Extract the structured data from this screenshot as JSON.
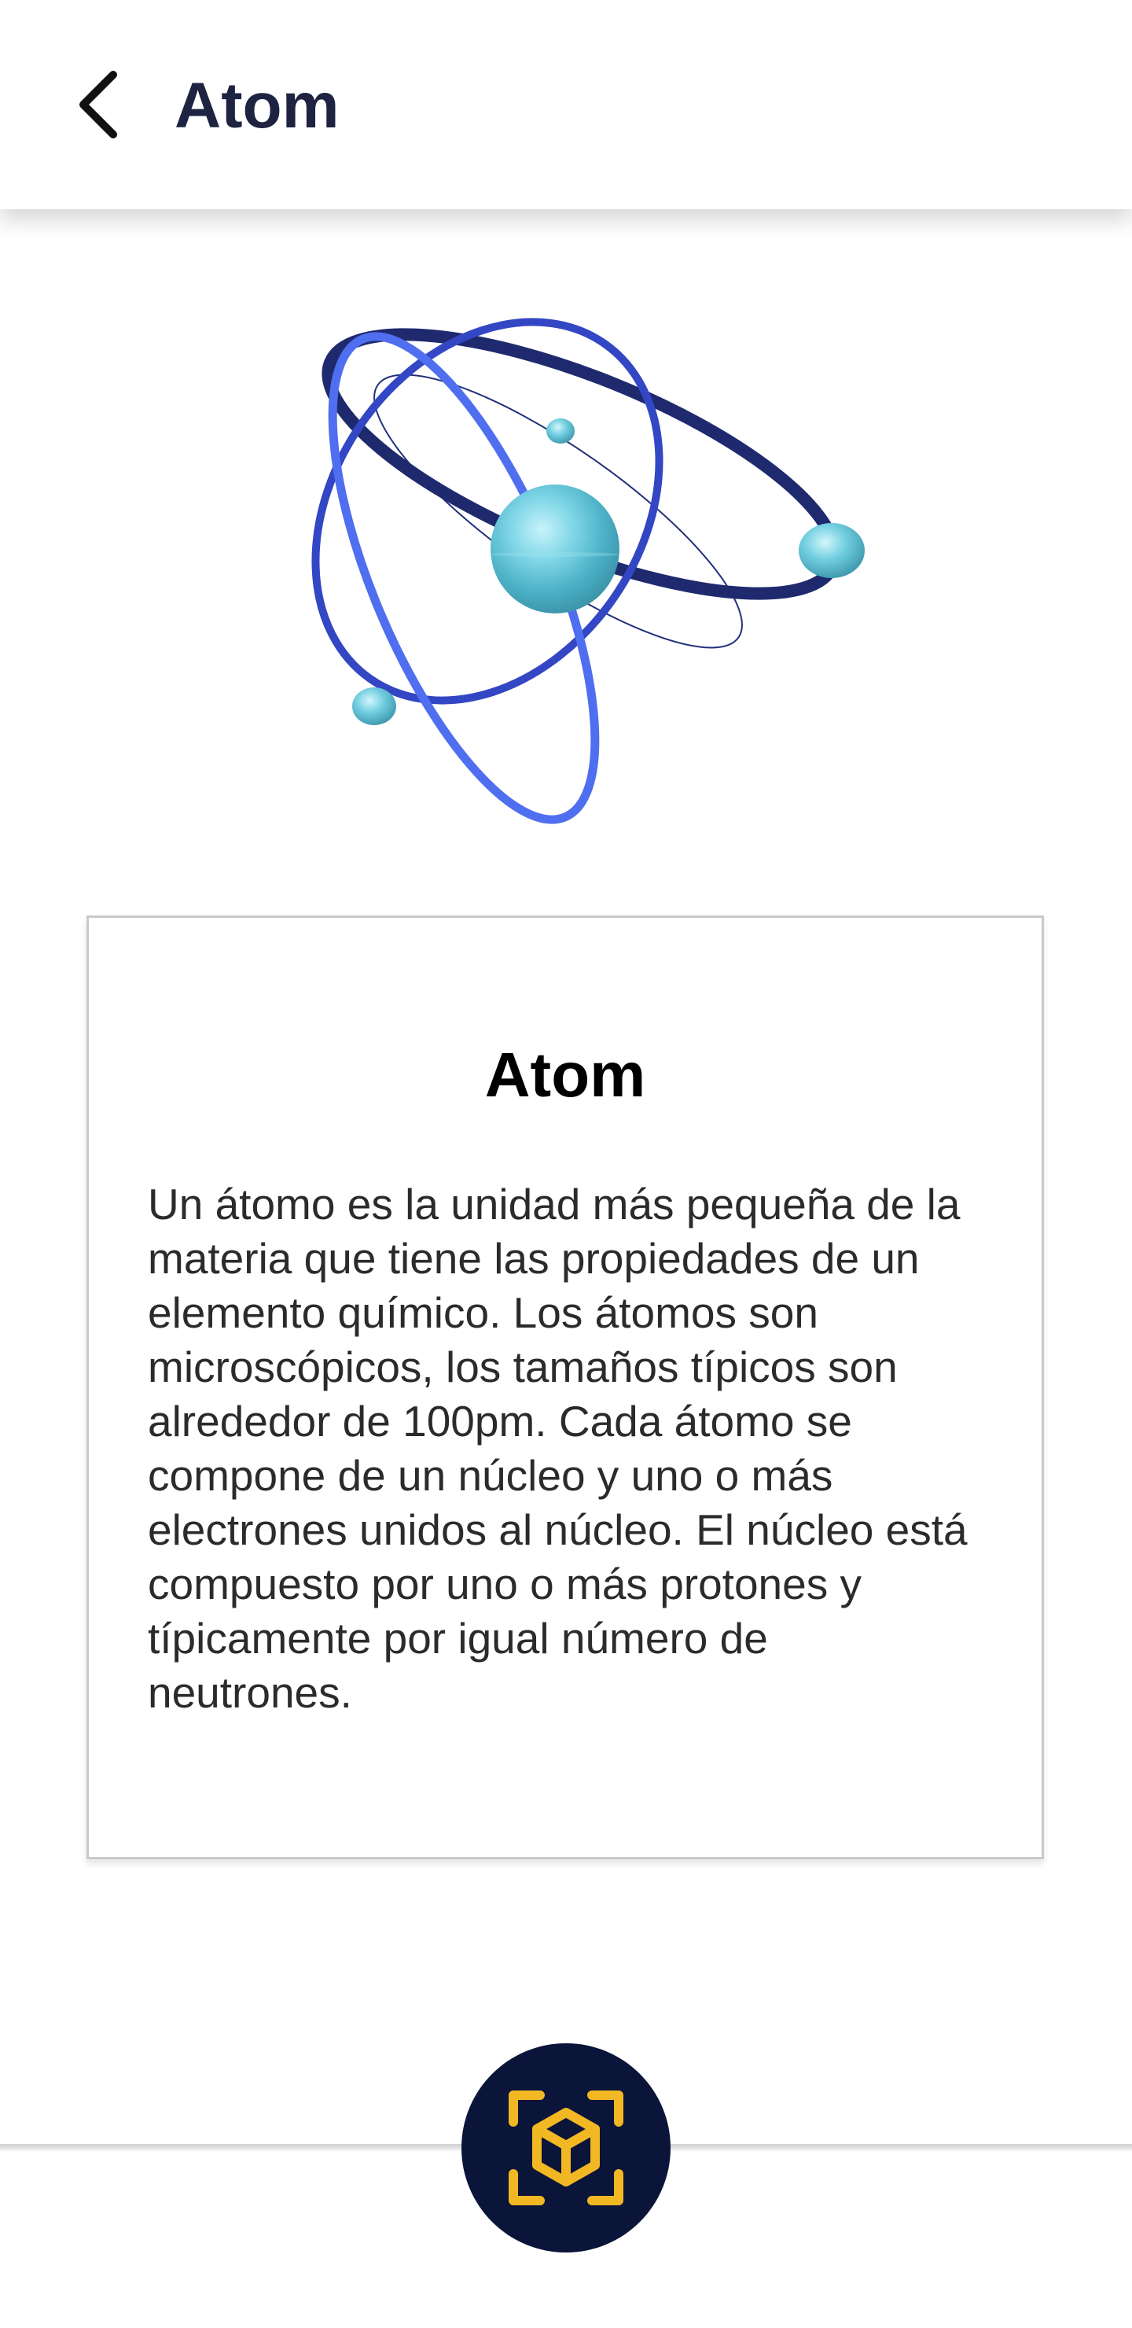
{
  "app_bar": {
    "title": "Atom",
    "back_icon": "chevron-left-icon"
  },
  "illustration": {
    "subject": "atom-model",
    "colors": {
      "orbit_dark": "#1f2a6e",
      "orbit_mid": "#3346c4",
      "orbit_light": "#4f6ef0",
      "electron": "#5cc8db",
      "nucleus": "#6fc9dc"
    }
  },
  "card": {
    "title": "Atom",
    "body": "Un átomo es la unidad más pequeña de la materia que tiene las propiedades de un elemento químico. Los átomos son microscópicos, los tamaños típicos son alrededor de 100pm. Cada átomo se compone de un núcleo y uno o más electrones unidos al núcleo. El núcleo está compuesto por uno o más protones y típicamente por igual número de neutrones."
  },
  "ar_button": {
    "icon": "ar-cube-icon",
    "background": "#0b1439",
    "icon_color": "#f2b824"
  }
}
